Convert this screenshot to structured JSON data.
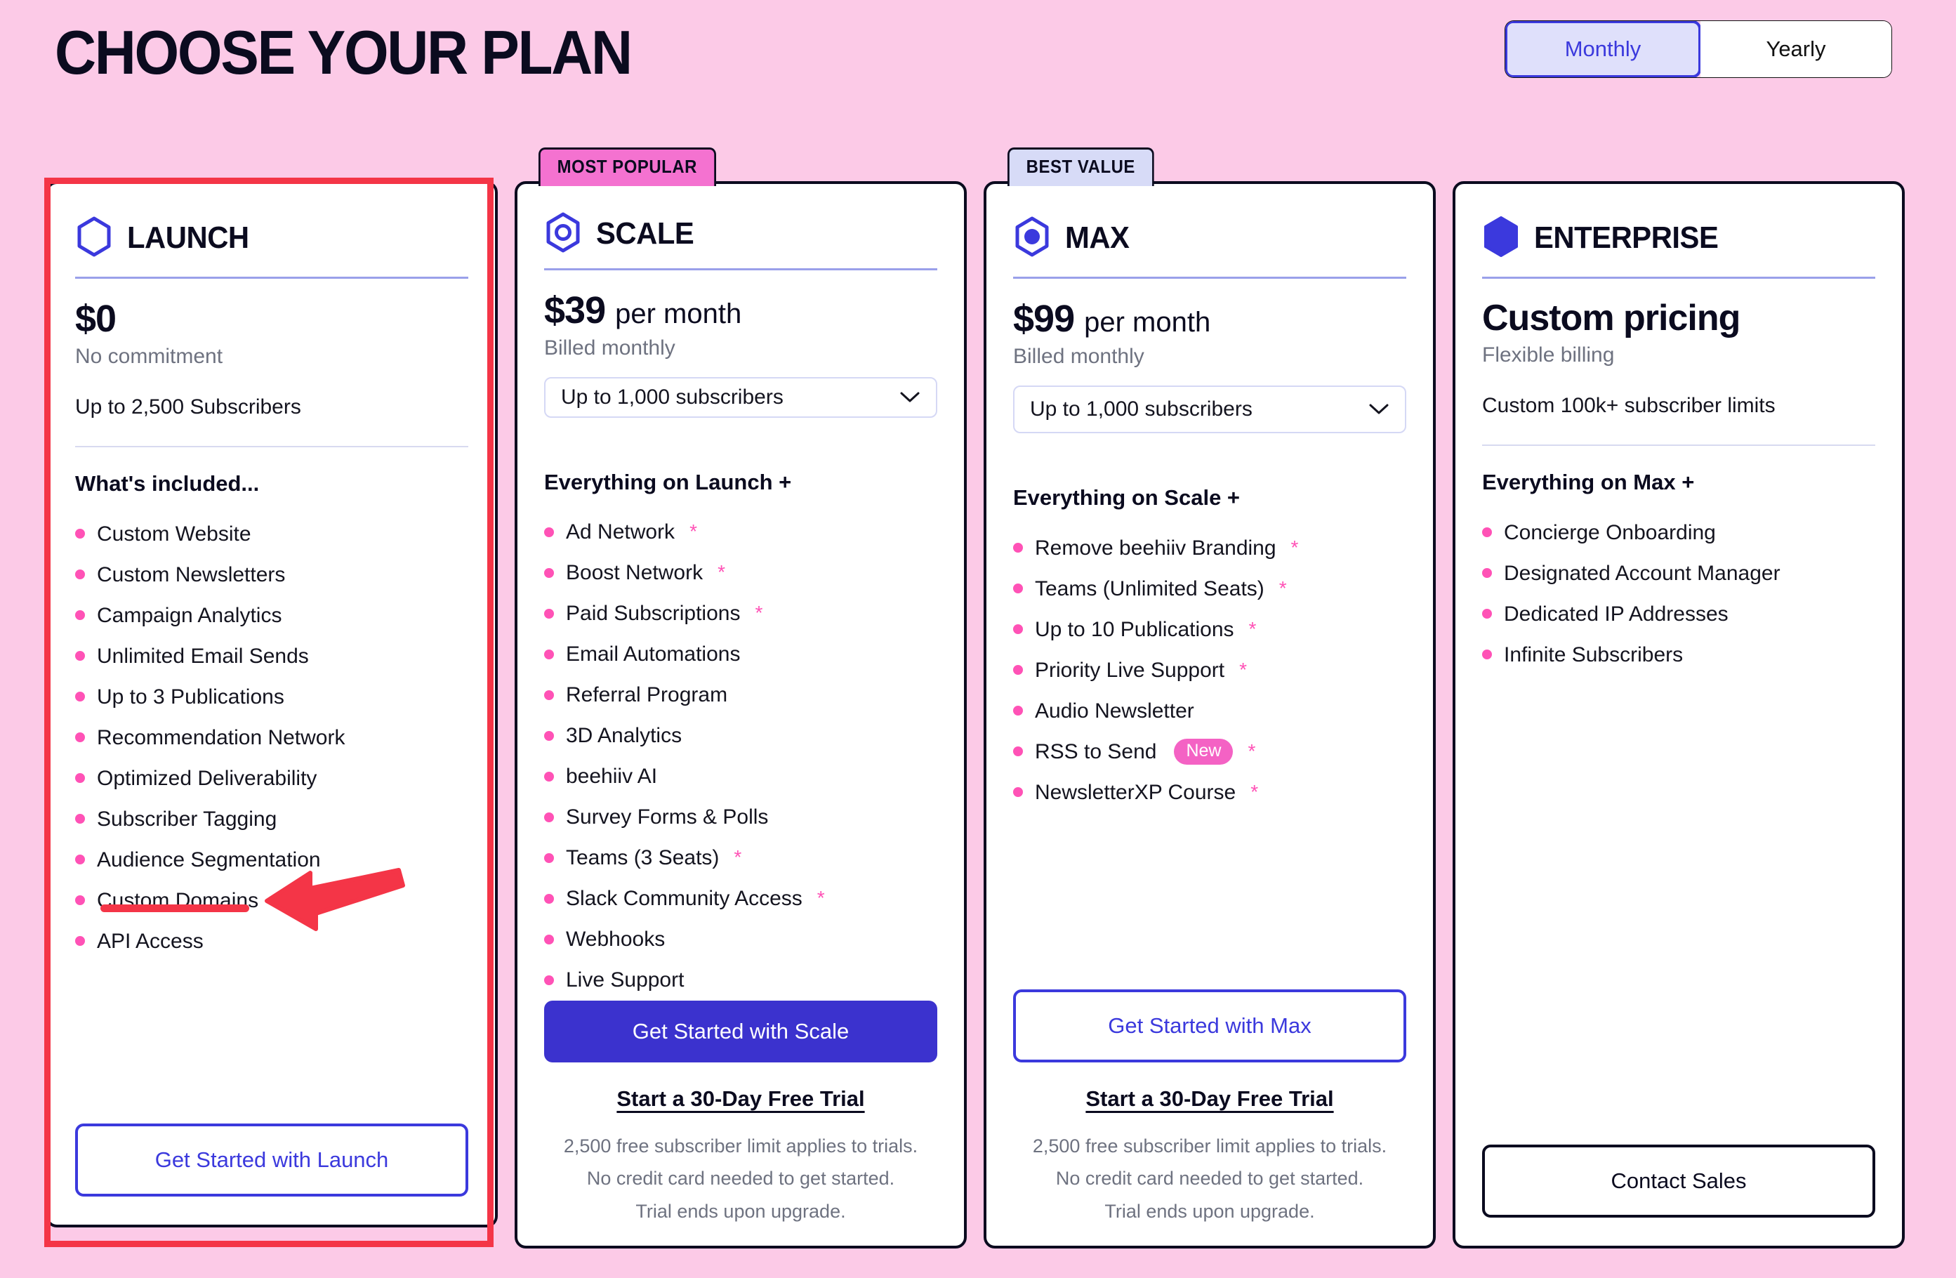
{
  "header": {
    "title": "CHOOSE YOUR PLAN",
    "billing_toggle": {
      "monthly_label": "Monthly",
      "yearly_label": "Yearly",
      "selected": "Monthly"
    }
  },
  "colors": {
    "background": "#FCCAE7",
    "accent_blue": "#3B39DD",
    "accent_pink": "#FF52B6",
    "badge_popular": "#F472D0",
    "badge_best": "#D7DBF7",
    "annotation_red": "#F43547",
    "text_dark": "#0B0B1F",
    "text_muted": "#6E7280"
  },
  "plans": [
    {
      "id": "launch",
      "name": "LAUNCH",
      "icon": "hexagon-outline-icon",
      "badge": null,
      "price_amount": "$0",
      "price_period": "",
      "price_sub": "No commitment",
      "subscriber_line": "Up to 2,500 Subscribers",
      "select": null,
      "features_title": "What's included...",
      "features": [
        {
          "label": "Custom Website",
          "star": false
        },
        {
          "label": "Custom Newsletters",
          "star": false
        },
        {
          "label": "Campaign Analytics",
          "star": false
        },
        {
          "label": "Unlimited Email Sends",
          "star": false
        },
        {
          "label": "Up to 3 Publications",
          "star": false
        },
        {
          "label": "Recommendation Network",
          "star": false
        },
        {
          "label": "Optimized Deliverability",
          "star": false
        },
        {
          "label": "Subscriber Tagging",
          "star": false
        },
        {
          "label": "Audience Segmentation",
          "star": false
        },
        {
          "label": "Custom Domains",
          "star": false
        },
        {
          "label": "API Access",
          "star": false
        }
      ],
      "cta_label": "Get Started with Launch",
      "cta_style": "outline-blue",
      "trial_link": null,
      "trial_notes": []
    },
    {
      "id": "scale",
      "name": "SCALE",
      "icon": "hexagon-circle-outline-icon",
      "badge": "MOST POPULAR",
      "price_amount": "$39",
      "price_period": "per month",
      "price_sub": "Billed monthly",
      "subscriber_line": null,
      "select": {
        "value": "Up to 1,000 subscribers",
        "icon": "chevron-down-icon"
      },
      "features_title": "Everything on Launch +",
      "features": [
        {
          "label": "Ad Network",
          "star": true
        },
        {
          "label": "Boost Network",
          "star": true
        },
        {
          "label": "Paid Subscriptions",
          "star": true
        },
        {
          "label": "Email Automations",
          "star": false
        },
        {
          "label": "Referral Program",
          "star": false
        },
        {
          "label": "3D Analytics",
          "star": false
        },
        {
          "label": "beehiiv AI",
          "star": false
        },
        {
          "label": "Survey Forms & Polls",
          "star": false
        },
        {
          "label": "Teams (3 Seats)",
          "star": true
        },
        {
          "label": "Slack Community Access",
          "star": true
        },
        {
          "label": "Webhooks",
          "star": false
        },
        {
          "label": "Live Support",
          "star": false
        }
      ],
      "cta_label": "Get Started with Scale",
      "cta_style": "filled-blue",
      "trial_link": "Start a 30-Day Free Trial",
      "trial_notes": [
        "2,500 free subscriber limit applies to trials.",
        "No credit card needed to get started.",
        "Trial ends upon upgrade."
      ]
    },
    {
      "id": "max",
      "name": "MAX",
      "icon": "hexagon-filled-circle-icon",
      "badge": "BEST VALUE",
      "price_amount": "$99",
      "price_period": "per month",
      "price_sub": "Billed monthly",
      "subscriber_line": null,
      "select": {
        "value": "Up to 1,000 subscribers",
        "icon": "chevron-down-icon"
      },
      "features_title": "Everything on Scale +",
      "features": [
        {
          "label": "Remove beehiiv Branding",
          "star": true
        },
        {
          "label": "Teams (Unlimited Seats)",
          "star": true
        },
        {
          "label": "Up to 10 Publications",
          "star": true
        },
        {
          "label": "Priority Live Support",
          "star": true
        },
        {
          "label": "Audio Newsletter",
          "star": false
        },
        {
          "label": "RSS to Send",
          "star": true,
          "pill": "New"
        },
        {
          "label": "NewsletterXP Course",
          "star": true
        }
      ],
      "cta_label": "Get Started with Max",
      "cta_style": "outline-blue",
      "trial_link": "Start a 30-Day Free Trial",
      "trial_notes": [
        "2,500 free subscriber limit applies to trials.",
        "No credit card needed to get started.",
        "Trial ends upon upgrade."
      ]
    },
    {
      "id": "enterprise",
      "name": "ENTERPRISE",
      "icon": "hexagon-filled-icon",
      "badge": null,
      "price_amount": "Custom pricing",
      "price_period": "",
      "price_sub": "Flexible billing",
      "subscriber_line": "Custom 100k+ subscriber limits",
      "select": null,
      "features_title": "Everything on Max +",
      "features": [
        {
          "label": "Concierge Onboarding",
          "star": false
        },
        {
          "label": "Designated Account Manager",
          "star": false
        },
        {
          "label": "Dedicated IP Addresses",
          "star": false
        },
        {
          "label": "Infinite Subscribers",
          "star": false
        }
      ],
      "cta_label": "Contact Sales",
      "cta_style": "outline-dark",
      "trial_link": null,
      "trial_notes": []
    }
  ],
  "annotations": {
    "highlight_plan": "launch",
    "underlined_feature": "Custom Domains",
    "arrow": "left-pointing-arrow"
  }
}
